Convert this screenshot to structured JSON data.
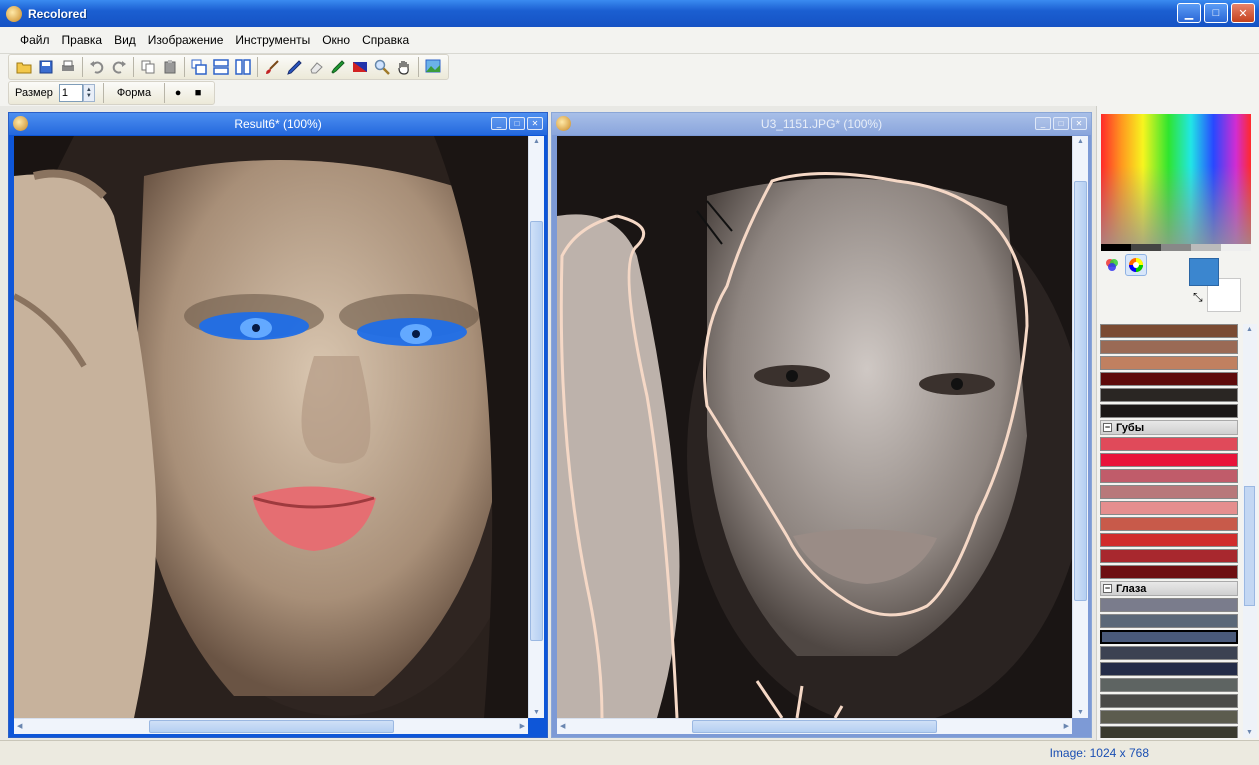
{
  "app": {
    "title": "Recolored",
    "icon": "palette-icon"
  },
  "window_controls": {
    "minimize": "▁",
    "maximize": "□",
    "close": "✕"
  },
  "menu": [
    "Файл",
    "Правка",
    "Вид",
    "Изображение",
    "Инструменты",
    "Окно",
    "Справка"
  ],
  "toolbar": {
    "icons": [
      "open-folder-icon",
      "save-icon",
      "print-icon",
      "undo-icon",
      "redo-icon",
      "copy-icon",
      "paste-icon",
      "cascade-windows-icon",
      "tile-horizontal-icon",
      "tile-vertical-icon",
      "brush-icon",
      "pencil-icon",
      "eraser-icon",
      "eyedropper-icon",
      "color-replace-icon",
      "zoom-icon",
      "hand-icon",
      "fit-image-icon"
    ]
  },
  "brush": {
    "size_label": "Размер",
    "size_value": "1",
    "shape_label": "Форма",
    "shapes": [
      "●",
      "■"
    ]
  },
  "windows": [
    {
      "title": "Result6* (100%)",
      "active": true
    },
    {
      "title": "U3_1151.JPG* (100%)",
      "active": false
    }
  ],
  "colors": {
    "primary": "#3b86cf",
    "secondary": "#ffffff"
  },
  "palette": {
    "top_swatches": [
      "#7a4a32",
      "#9a6a55",
      "#c08060",
      "#5e0a0a",
      "#2a2623",
      "#1a1716"
    ],
    "groups": [
      {
        "name": "Губы",
        "swatches": [
          "#e04a5a",
          "#e8143a",
          "#c05c6a",
          "#b8787a",
          "#e58e8e",
          "#c85a4a",
          "#d02c2c",
          "#a8282e",
          "#6e0f12"
        ]
      },
      {
        "name": "Глаза",
        "swatches": [
          "#7a7c8c",
          "#5b6878",
          "#4a5a7a",
          "#3c4252",
          "#242c48",
          "#5e6462",
          "#4a4a48",
          "#5c5c4e",
          "#3a3a2e"
        ]
      }
    ]
  },
  "status": {
    "image_size": "Image: 1024 x 768"
  }
}
